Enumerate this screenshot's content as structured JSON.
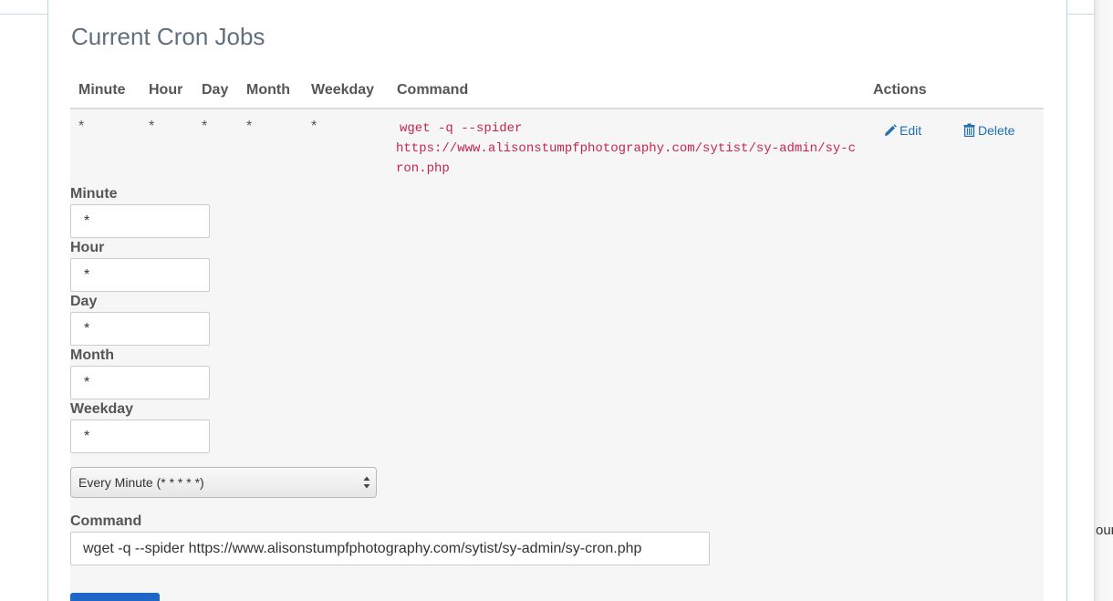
{
  "panel": {
    "title": "Current Cron Jobs"
  },
  "table": {
    "headers": {
      "minute": "Minute",
      "hour": "Hour",
      "day": "Day",
      "month": "Month",
      "weekday": "Weekday",
      "command": "Command",
      "actions": "Actions"
    },
    "job": {
      "minute": "*",
      "hour": "*",
      "day": "*",
      "month": "*",
      "weekday": "*",
      "command_line1": "wget -q --spider",
      "command_line2": "https://www.alisonstumpfphotography.com/sytist/sy-admin/sy-cron.php",
      "edit_label": "Edit",
      "delete_label": "Delete"
    }
  },
  "edit_form": {
    "minute_label": "Minute",
    "minute_value": "*",
    "hour_label": "Hour",
    "hour_value": "*",
    "day_label": "Day",
    "day_value": "*",
    "month_label": "Month",
    "month_value": "*",
    "weekday_label": "Weekday",
    "weekday_value": "*",
    "preset_selected": "Every Minute (* * * * *)",
    "command_label": "Command",
    "command_value": "wget -q --spider https://www.alisonstumpfphotography.com/sytist/sy-admin/sy-cron.php"
  },
  "side_fragment": "our",
  "colors": {
    "link": "#1f6fb5",
    "code": "#c7254e",
    "primary_button": "#1e66c8",
    "panel_border": "#bcd2e8"
  },
  "icons": {
    "edit": "pencil-icon",
    "delete": "trash-icon",
    "select": "select-arrows-icon"
  }
}
